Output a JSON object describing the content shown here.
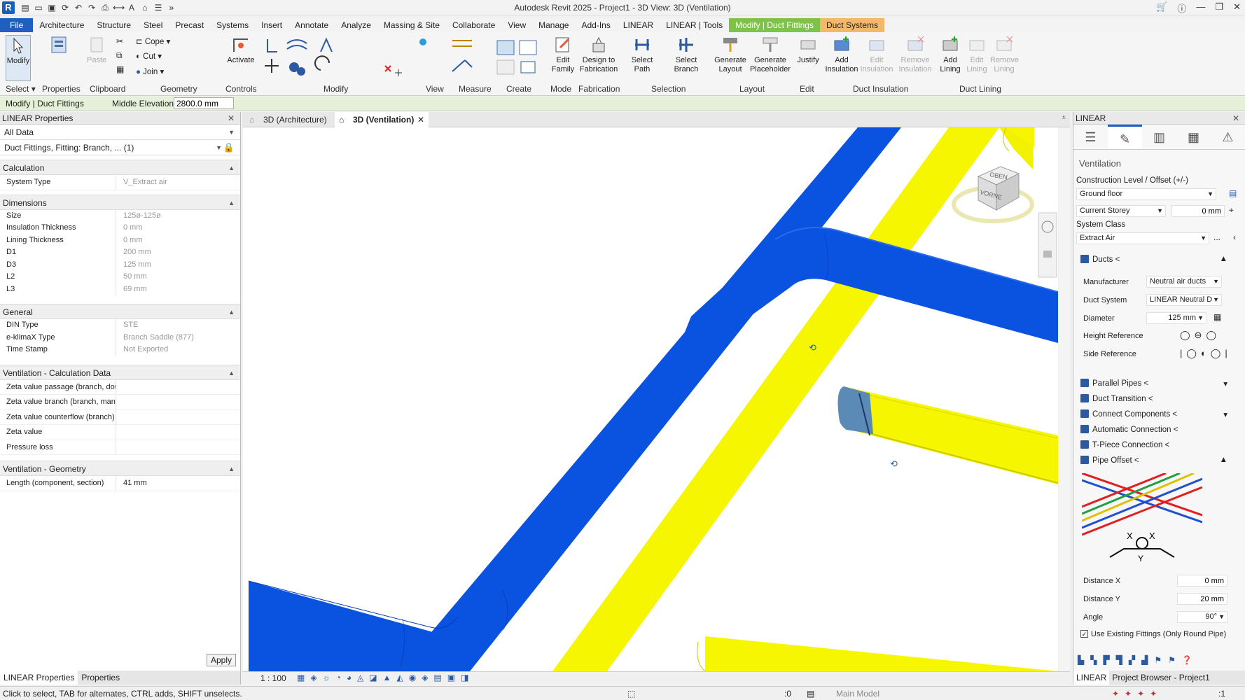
{
  "app": {
    "title": "Autodesk Revit 2025 - Project1 - 3D View: 3D (Ventilation)",
    "logo": "R"
  },
  "menu": [
    "File",
    "Architecture",
    "Structure",
    "Steel",
    "Precast",
    "Systems",
    "Insert",
    "Annotate",
    "Analyze",
    "Massing & Site",
    "Collaborate",
    "View",
    "Manage",
    "Add-Ins",
    "LINEAR",
    "LINEAR | Tools",
    "Modify | Duct Fittings",
    "Duct Systems"
  ],
  "ribbon": {
    "modify": "Modify",
    "select_panel": "Select",
    "properties_panel": "Properties",
    "paste": "Paste",
    "clipboard_panel": "Clipboard",
    "cope": "Cope",
    "cut": "Cut",
    "join": "Join",
    "geometry_panel": "Geometry",
    "activate": "Activate",
    "controls_panel": "Controls",
    "modify_panel": "Modify",
    "view_panel": "View",
    "measure_panel": "Measure",
    "create_panel": "Create",
    "edit_family": "Edit\nFamily",
    "mode_panel": "Mode",
    "design_to_fab": "Design to\nFabrication",
    "fabrication_panel": "Fabrication",
    "select_path": "Select Path",
    "select_branch": "Select Branch",
    "selection_panel": "Selection",
    "generate_layout": "Generate\nLayout",
    "generate_placeholder": "Generate\nPlaceholder",
    "layout_panel": "Layout",
    "justify": "Justify",
    "edit_panel": "Edit",
    "add_insulation": "Add\nInsulation",
    "edit_insulation": "Edit\nInsulation",
    "remove_insulation": "Remove\nInsulation",
    "duct_insulation_panel": "Duct Insulation",
    "add_lining": "Add\nLining",
    "edit_lining": "Edit\nLining",
    "remove_lining": "Remove\nLining",
    "duct_lining_panel": "Duct Lining"
  },
  "options_bar": {
    "context": "Modify | Duct Fittings",
    "middle_elevation_label": "Middle Elevation:",
    "middle_elevation_value": "2800.0 mm"
  },
  "properties": {
    "title": "LINEAR Properties",
    "filter": "All Data",
    "selection": "Duct Fittings, Fitting: Branch, ... (1)",
    "sections": {
      "calculation": "Calculation",
      "dimensions": "Dimensions",
      "general": "General",
      "vent_calc": "Ventilation - Calculation Data",
      "vent_geom": "Ventilation - Geometry"
    },
    "system_type": {
      "k": "System Type",
      "v": "V_Extract air"
    },
    "size": {
      "k": "Size",
      "v": "125ø-125ø"
    },
    "insulation": {
      "k": "Insulation Thickness",
      "v": "0 mm"
    },
    "lining": {
      "k": "Lining Thickness",
      "v": "0 mm"
    },
    "d1": {
      "k": "D1",
      "v": "200 mm"
    },
    "d3": {
      "k": "D3",
      "v": "125 mm"
    },
    "l2": {
      "k": "L2",
      "v": "50 mm"
    },
    "l3": {
      "k": "L3",
      "v": "69 mm"
    },
    "din": {
      "k": "DIN Type",
      "v": "STE"
    },
    "eklima": {
      "k": "e-klimaX Type",
      "v": "Branch Saddle (877)"
    },
    "timestamp": {
      "k": "Time Stamp",
      "v": "Not Exported"
    },
    "zeta_pass": {
      "k": "Zeta value passage (branch, doul",
      "v": ""
    },
    "zeta_branch": {
      "k": "Zeta value branch (branch, manif",
      "v": ""
    },
    "zeta_counter": {
      "k": "Zeta value counterflow (branch)",
      "v": ""
    },
    "zeta": {
      "k": "Zeta value",
      "v": ""
    },
    "pressure": {
      "k": "Pressure loss",
      "v": ""
    },
    "length": {
      "k": "Length (component, section)",
      "v": "41 mm"
    },
    "apply": "Apply",
    "tab_linear": "LINEAR Properties",
    "tab_props": "Properties"
  },
  "view_tabs": {
    "arch": "3D (Architecture)",
    "vent": "3D (Ventilation)"
  },
  "viewcube": {
    "top": "OBEN",
    "front": "VORNE"
  },
  "view_bar": {
    "scale": "1 : 100"
  },
  "linear_panel": {
    "title": "LINEAR",
    "section": "Ventilation",
    "construction_level_label": "Construction Level / Offset (+/-)",
    "level": "Ground floor",
    "storey": "Current Storey",
    "offset": "0 mm",
    "system_class_label": "System Class",
    "system_class": "Extract Air",
    "ducts": "Ducts <",
    "manufacturer_label": "Manufacturer",
    "manufacturer": "Neutral air ducts",
    "duct_system_label": "Duct System",
    "duct_system": "LINEAR Neutral D",
    "diameter_label": "Diameter",
    "diameter": "125 mm",
    "height_ref_label": "Height Reference",
    "side_ref_label": "Side Reference",
    "parallel_pipes": "Parallel Pipes <",
    "duct_transition": "Duct Transition <",
    "connect_components": "Connect Components <",
    "automatic_connection": "Automatic Connection <",
    "tpiece": "T-Piece Connection <",
    "pipe_offset": "Pipe Offset <",
    "distance_x_label": "Distance X",
    "distance_x": "0 mm",
    "distance_y_label": "Distance Y",
    "distance_y": "20 mm",
    "angle_label": "Angle",
    "angle": "90°",
    "use_existing": "Use Existing Fittings (Only Round Pipe)",
    "tab_linear": "LINEAR",
    "tab_browser": "Project Browser - Project1"
  },
  "status": {
    "hint": "Click to select, TAB for alternates, CTRL adds, SHIFT unselects.",
    "model": "Main Model",
    "zero": ":0",
    "filter_count": ":1"
  },
  "colors": {
    "blue_duct": "#0a52e0",
    "yellow_duct": "#f5f500",
    "accent": "#1f5fbf",
    "context_green": "#7fc24a"
  }
}
